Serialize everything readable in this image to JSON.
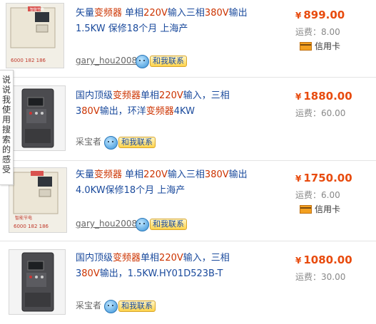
{
  "feedback_tab": "说说我使用搜索的感受",
  "contact_label": "和我联系",
  "credit_label": "信用卡",
  "items": [
    {
      "title_parts": [
        "矢量",
        "变频器",
        " 单相",
        "220V",
        "输入",
        "三相",
        "380V",
        "输出 1.5KW 保修18个月 上海产"
      ],
      "seller": "gary_hou2008",
      "price": "899.00",
      "currency": "¥",
      "shipping": "运费：8.00",
      "credit": true,
      "thumb_caption": "6000 182 186",
      "thumb_label": "智能节电"
    },
    {
      "title_parts": [
        "国内顶级",
        "变频器",
        "单相",
        "220V",
        "输入，三相3",
        "80V",
        "输出，环洋",
        "变频器",
        "4KW"
      ],
      "seller": "采宝者",
      "price": "1880.00",
      "currency": "¥",
      "shipping": "运费：60.00",
      "credit": false
    },
    {
      "title_parts": [
        "矢量",
        "变频器",
        " 单相",
        "220V",
        "输入",
        "三相",
        "380V",
        "输出 4.0KW保修18个月 上海产"
      ],
      "seller": "gary_hou2008",
      "price": "1750.00",
      "currency": "¥",
      "shipping": "运费：6.00",
      "credit": true,
      "thumb_caption": "6000 182 186",
      "thumb_label": "智能节电"
    },
    {
      "title_parts": [
        "国内顶级",
        "变频器",
        "单相",
        "220V",
        "输入，三相3",
        "80V",
        "输出，1.5KW.HY01D523B-T"
      ],
      "seller": "采宝者",
      "price": "1080.00",
      "currency": "¥",
      "shipping": "运费：30.00",
      "credit": false
    }
  ],
  "colors": {
    "link": "#1a4a9c",
    "highlight": "#cc3300",
    "price": "#e84b0e"
  }
}
